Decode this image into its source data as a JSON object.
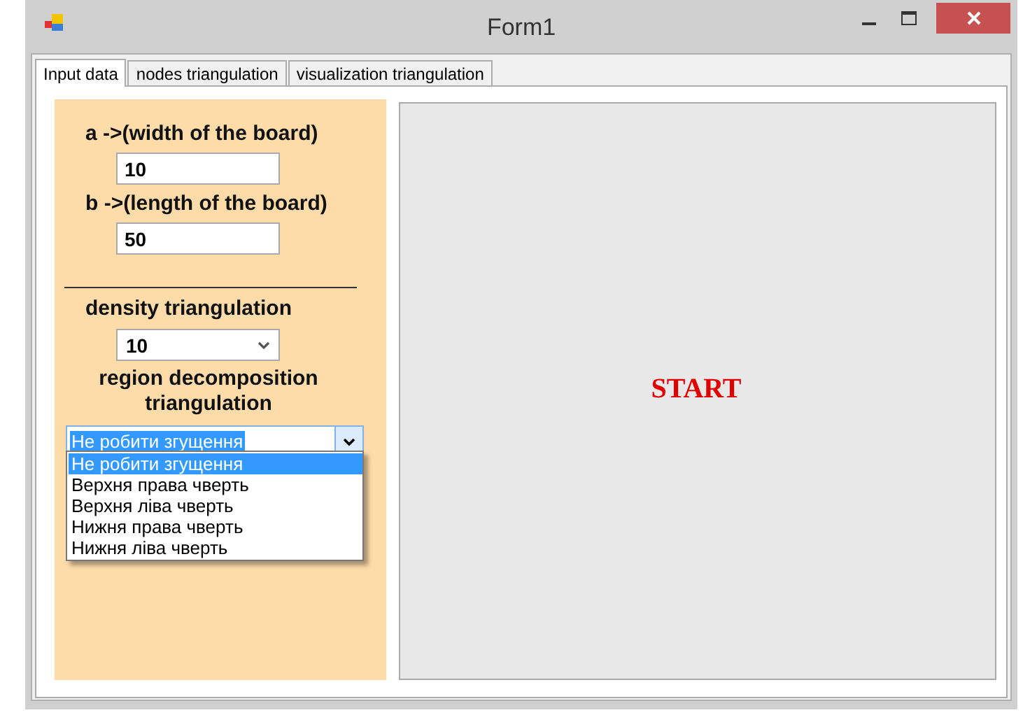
{
  "window": {
    "title": "Form1"
  },
  "tabs": [
    {
      "label": "Input data",
      "selected": true
    },
    {
      "label": "nodes triangulation",
      "selected": false
    },
    {
      "label": "visualization triangulation",
      "selected": false
    }
  ],
  "fields": [
    {
      "label": "a ->(width of the board)",
      "value": "10"
    },
    {
      "label": "b ->(length of the board)",
      "value": "50"
    }
  ],
  "density": {
    "label": "density triangulation",
    "value": "10"
  },
  "region": {
    "label": "region decomposition triangulation",
    "value": "Не робити згущення",
    "expanded": true,
    "options": [
      {
        "label": "Не робити згущення",
        "selected": true
      },
      {
        "label": "Верхня права чверть",
        "selected": false
      },
      {
        "label": "Верхня ліва чверть",
        "selected": false
      },
      {
        "label": "Нижня права чверть",
        "selected": false
      },
      {
        "label": "Нижня ліва чверть",
        "selected": false
      }
    ]
  },
  "canvas": {
    "text": "START"
  }
}
